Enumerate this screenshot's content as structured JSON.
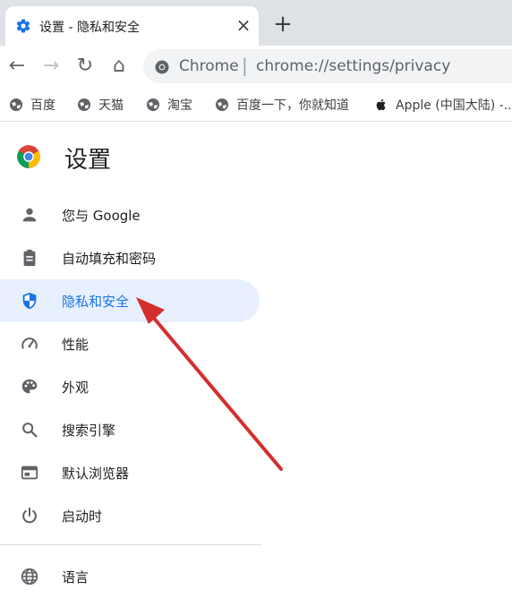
{
  "tab": {
    "title": "设置 - 隐私和安全",
    "close_glyph": "×",
    "new_tab_glyph": "+"
  },
  "toolbar": {
    "back_glyph": "←",
    "forward_glyph": "→",
    "reload_glyph": "↻",
    "home_glyph": "⌂",
    "site_label": "Chrome",
    "separator": "|",
    "url": "chrome://settings/privacy"
  },
  "bookmarks": [
    {
      "label": "百度",
      "icon": "globe-icon"
    },
    {
      "label": "天猫",
      "icon": "globe-icon"
    },
    {
      "label": "淘宝",
      "icon": "globe-icon"
    },
    {
      "label": "百度一下，你就知道",
      "icon": "globe-icon"
    },
    {
      "label": "Apple (中国大陆) -...",
      "icon": "apple-icon"
    }
  ],
  "settings": {
    "title": "设置"
  },
  "nav": [
    {
      "label": "您与 Google",
      "icon": "person-icon",
      "selected": false
    },
    {
      "label": "自动填充和密码",
      "icon": "clipboard-icon",
      "selected": false
    },
    {
      "label": "隐私和安全",
      "icon": "shield-icon",
      "selected": true
    },
    {
      "label": "性能",
      "icon": "speedometer-icon",
      "selected": false
    },
    {
      "label": "外观",
      "icon": "palette-icon",
      "selected": false
    },
    {
      "label": "搜索引擎",
      "icon": "search-icon",
      "selected": false
    },
    {
      "label": "默认浏览器",
      "icon": "browser-icon",
      "selected": false
    },
    {
      "label": "启动时",
      "icon": "power-icon",
      "selected": false
    },
    {
      "label": "语言",
      "icon": "globe-icon",
      "selected": false
    }
  ],
  "colors": {
    "accent": "#1a73e8",
    "selected_bg": "#e8f0fe",
    "annotation_arrow": "#d32f2f"
  }
}
